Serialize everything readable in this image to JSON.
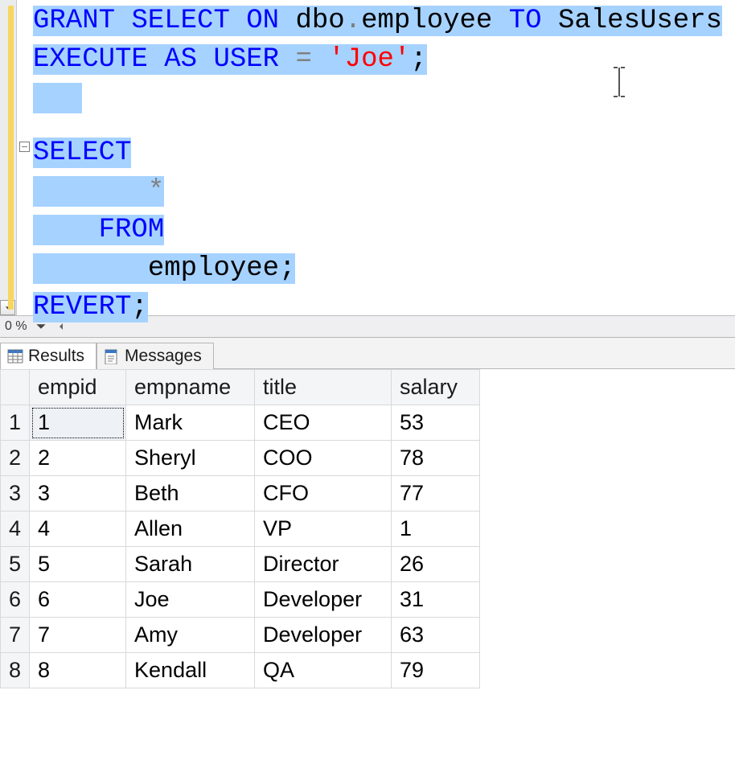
{
  "sql": {
    "line1": {
      "grant": "GRANT",
      "select": "SELECT",
      "on": "ON",
      "object": "dbo",
      "dot": ".",
      "table": "employee",
      "to": "TO",
      "role": "SalesUsers"
    },
    "line2": {
      "execute": "EXECUTE",
      "as": "AS",
      "user": "USER",
      "eq": "=",
      "value": "'Joe'",
      "semi": ";"
    },
    "line4": {
      "select": "SELECT"
    },
    "line5": {
      "star": "*"
    },
    "line6": {
      "from": "FROM"
    },
    "line7": {
      "table": "employee",
      "semi": ";"
    },
    "line8": {
      "revert": "REVERT",
      "semi": ";"
    }
  },
  "zoom": {
    "percent": "0 %"
  },
  "tabs": {
    "results": "Results",
    "messages": "Messages"
  },
  "grid": {
    "headers": {
      "c1": "empid",
      "c2": "empname",
      "c3": "title",
      "c4": "salary"
    },
    "rows": [
      {
        "n": "1",
        "empid": "1",
        "empname": "Mark",
        "title": "CEO",
        "salary": "53"
      },
      {
        "n": "2",
        "empid": "2",
        "empname": "Sheryl",
        "title": "COO",
        "salary": "78"
      },
      {
        "n": "3",
        "empid": "3",
        "empname": "Beth",
        "title": "CFO",
        "salary": "77"
      },
      {
        "n": "4",
        "empid": "4",
        "empname": "Allen",
        "title": "VP",
        "salary": "1"
      },
      {
        "n": "5",
        "empid": "5",
        "empname": "Sarah",
        "title": "Director",
        "salary": "26"
      },
      {
        "n": "6",
        "empid": "6",
        "empname": "Joe",
        "title": "Developer",
        "salary": "31"
      },
      {
        "n": "7",
        "empid": "7",
        "empname": "Amy",
        "title": "Developer",
        "salary": "63"
      },
      {
        "n": "8",
        "empid": "8",
        "empname": "Kendall",
        "title": "QA",
        "salary": "79"
      }
    ]
  },
  "chart_data": {
    "type": "table",
    "columns": [
      "empid",
      "empname",
      "title",
      "salary"
    ],
    "rows": [
      [
        1,
        "Mark",
        "CEO",
        53
      ],
      [
        2,
        "Sheryl",
        "COO",
        78
      ],
      [
        3,
        "Beth",
        "CFO",
        77
      ],
      [
        4,
        "Allen",
        "VP",
        1
      ],
      [
        5,
        "Sarah",
        "Director",
        26
      ],
      [
        6,
        "Joe",
        "Developer",
        31
      ],
      [
        7,
        "Amy",
        "Developer",
        63
      ],
      [
        8,
        "Kendall",
        "QA",
        79
      ]
    ]
  }
}
